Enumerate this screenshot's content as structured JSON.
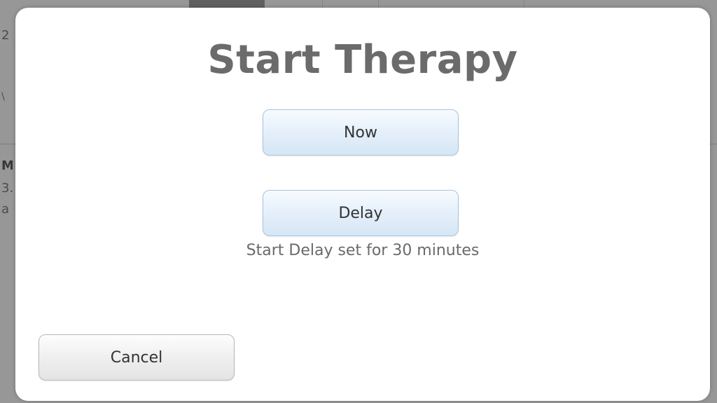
{
  "dialog": {
    "title": "Start Therapy",
    "now_label": "Now",
    "delay_label": "Delay",
    "delay_status": "Start Delay set for 30 minutes",
    "cancel_label": "Cancel"
  },
  "background": {
    "fragments": [
      "2",
      "\\",
      "M",
      "3.",
      "a"
    ]
  },
  "colors": {
    "title": "#6b6b6b",
    "primary_button_fill": "#e3eef9",
    "primary_button_border": "#a9c4dc",
    "secondary_button_fill": "#eeeeee"
  }
}
